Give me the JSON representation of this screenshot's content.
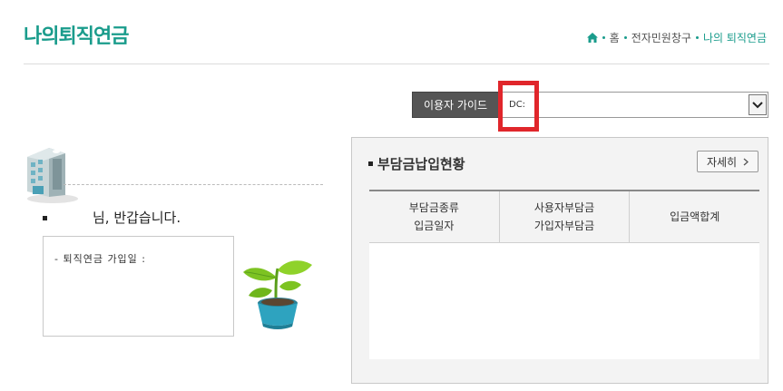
{
  "page_title": "나의퇴직연금",
  "breadcrumb": {
    "home_icon": "home-icon",
    "items": [
      "홈",
      "전자민원창구"
    ],
    "current": "나의 퇴직연금"
  },
  "guide": {
    "button_label": "이용자 가이드",
    "select_value": "DC:"
  },
  "colors": {
    "accent": "#1a9c8c",
    "highlight": "#e0262b",
    "button_dark": "#555555"
  },
  "user": {
    "greeting": "님, 반갑습니다.",
    "join_date_label": "- 퇴직연금 가입일 :"
  },
  "payment": {
    "title": "부담금납입현황",
    "detail_button": "자세히",
    "columns": [
      {
        "line1": "부담금종류",
        "line2": "입금일자"
      },
      {
        "line1": "사용자부담금",
        "line2": "가입자부담금"
      },
      {
        "line1": "입금액합계",
        "line2": ""
      }
    ]
  },
  "icons": {
    "building": "building-icon",
    "plant": "plant-icon",
    "chevron": "chevron-right-icon",
    "dropdown": "chevron-down-icon"
  }
}
